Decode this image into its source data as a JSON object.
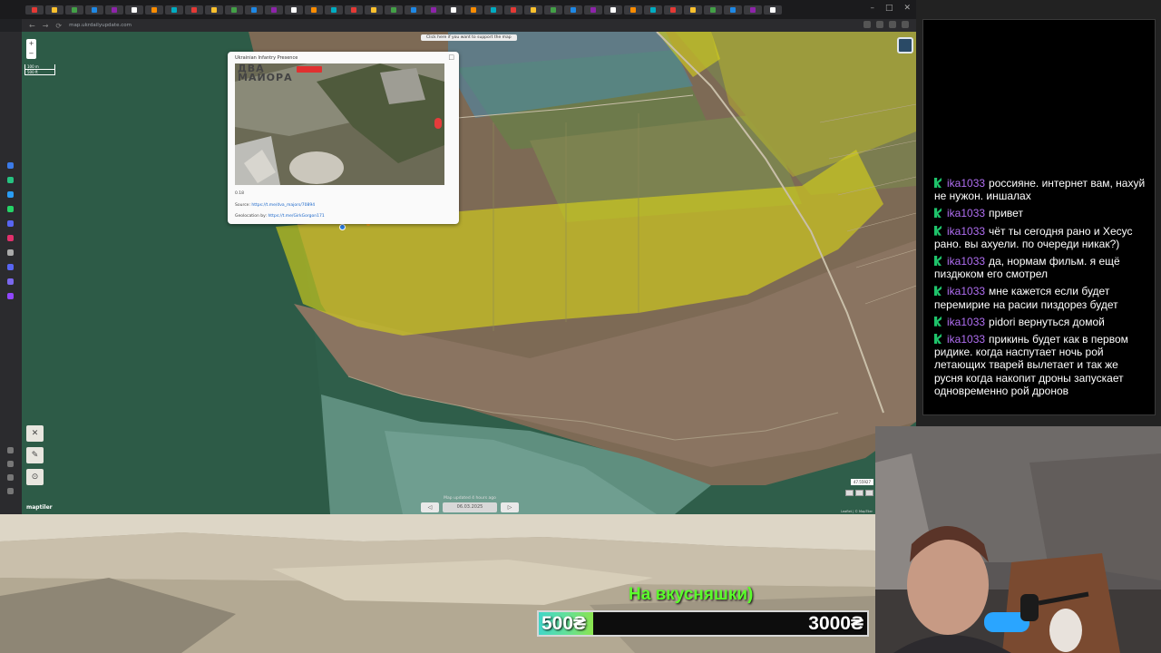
{
  "browser": {
    "url": "map.ukrdailyupdate.com",
    "nav": {
      "back": "←",
      "forward": "→",
      "reload": "⟳"
    },
    "window_controls": [
      "–",
      "□",
      "✕"
    ]
  },
  "map": {
    "top_note": "Click here if you want to support the map",
    "zoom_in": "+",
    "zoom_out": "−",
    "scale_labels": [
      "100 m",
      "500 ft"
    ],
    "logo": "maptiler",
    "coords": "47.55927",
    "date_bar": {
      "updated_note": "Map updated 4 hours ago",
      "prev": "◁",
      "next": "▷",
      "date": "06.03.2025"
    },
    "tools": [
      "✕",
      "✎",
      "⊙"
    ],
    "attribution": "Leaflet | © MapTiler"
  },
  "popup": {
    "title": "Ukrainian Infantry Presence",
    "close": "□",
    "video_watermark_line1": "ДВА",
    "video_watermark_line2": "МАЙОРА",
    "value": "0.18",
    "source_label": "Source:",
    "source_link": "https://t.me/dva_majors/70894",
    "geo_label": "Geolocation by:",
    "geo_link": "https://t.me/GirkGorgon171"
  },
  "chat": {
    "messages": [
      {
        "user": "ika1033",
        "text": "россияне. интернет вам, нахуй не нужон. иншалах"
      },
      {
        "user": "ika1033",
        "text": "привет"
      },
      {
        "user": "ika1033",
        "text": "чёт ты сегодня рано и Хесус рано. вы ахуели. по очереди никак?)"
      },
      {
        "user": "ika1033",
        "text": "да, нормам фильм. я ещё пиздюком его смотрел"
      },
      {
        "user": "ika1033",
        "text": "мне кажется если будет перемирие на расии пиздорез будет"
      },
      {
        "user": "ika1033",
        "text": "pidori вернуться домой"
      },
      {
        "user": "ika1033",
        "text": "прикинь будет как в первом ридике. когда наспутает ночь рой летающих тварей вылетает и так же русня когда накопит дроны запускает одновременно рой дронов"
      }
    ]
  },
  "donation": {
    "label": "На вкусняшки)",
    "current": "500₴",
    "goal": "3000₴",
    "progress": 0.1667
  },
  "colors": {
    "chat_user": "#b06ef2",
    "chat_badge": "#1ec36a",
    "donation_label": "#5bff2b",
    "zone_yellow": "#d9d419",
    "zone_blue": "#3d90c4"
  }
}
